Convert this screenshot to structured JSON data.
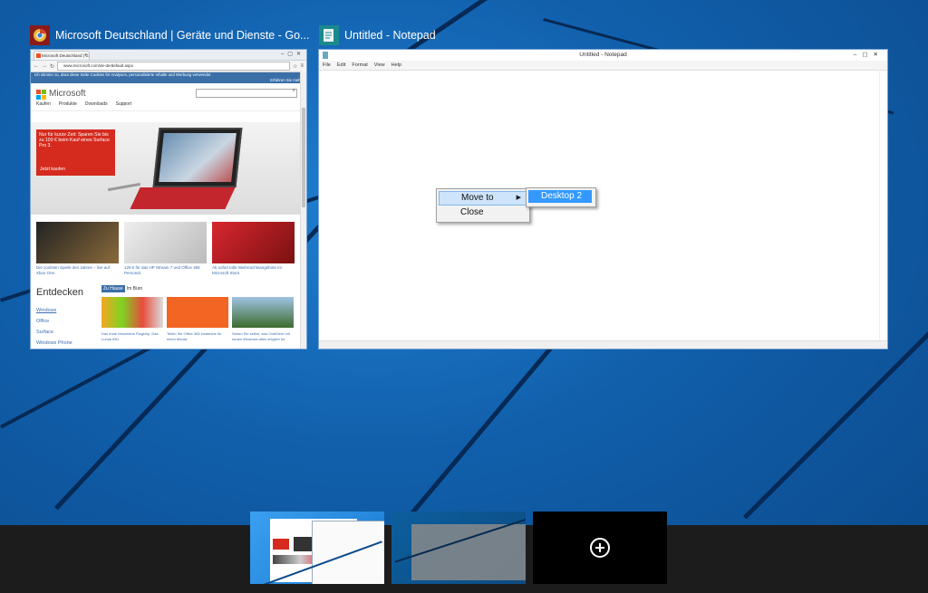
{
  "chrome_window": {
    "title": "Microsoft Deutschland | Geräte und Dienste - Go...",
    "tab_label": "Microsoft Deutschland | G",
    "url": "www.microsoft.com/de-de/default.aspx",
    "cookie_text": "Ich stimme zu, dass diese Seite Cookies für Analysen, personalisierte Inhalte und Werbung verwendet",
    "cookie_more": "Erfahren Sie mehr",
    "brand": "Microsoft",
    "nav": [
      "Kaufen",
      "Produkte",
      "Downloads",
      "Support"
    ],
    "hero_text": "Nur für kurze Zeit: Sparen Sie bis zu 100 € beim Kauf eines Surface Pro 3.",
    "hero_cta": "Jetzt kaufen",
    "tiles": [
      "Die coolsten Spiele des Jahres – live auf Xbox One.",
      "129 € für das HP Stream 7 und Office 365 Personal.",
      "Ab sofort tolle Weihnachtsangebote im Microsoft Store."
    ],
    "entdecken": "Entdecken",
    "side_links": [
      "Windows",
      "Office",
      "Surface",
      "Windows Phone"
    ],
    "tab_active": "Zu Hause",
    "tab_inactive": "Im Büro",
    "bottom_tiles": [
      "Das erste besonders Flagship. Das Lumia 830.",
      "Teilen Sie Office 365 kostenlos für einen Monat.",
      "Sehen Sie selbst, was OneDrive mit neuen Windows alles möglich ist."
    ]
  },
  "notepad_window": {
    "title": "Untitled - Notepad",
    "inner_title": "Untitled - Notepad",
    "menu": [
      "File",
      "Edit",
      "Format",
      "View",
      "Help"
    ]
  },
  "context_menu": {
    "move_to": "Move to",
    "close": "Close",
    "submenu_item": "Desktop 2"
  },
  "colors": {
    "accent": "#3399ff",
    "highlight": "#cde4fb",
    "desktop_bar": "#1c1c1c"
  }
}
